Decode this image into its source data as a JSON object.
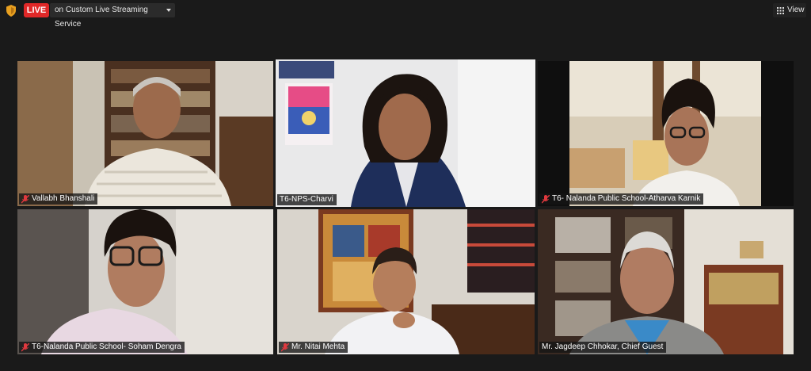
{
  "topbar": {
    "live_label": "LIVE",
    "stream_label": "on Custom Live Streaming Service",
    "view_label": "View"
  },
  "participants": [
    {
      "name": "Vallabh Bhanshali",
      "muted": true,
      "active": false
    },
    {
      "name": "T6-NPS-Charvi",
      "muted": false,
      "active": true
    },
    {
      "name": "T6- Nalanda Public School-Atharva Karnik",
      "muted": true,
      "active": false
    },
    {
      "name": "T6-Nalanda Public School- Soham Dengra",
      "muted": true,
      "active": false
    },
    {
      "name": "Mr. Nitai Mehta",
      "muted": true,
      "active": false
    },
    {
      "name": "Mr. Jagdeep Chhokar, Chief Guest",
      "muted": false,
      "active": false
    }
  ],
  "colors": {
    "live": "#e02828",
    "active_border": "#d4e35a",
    "muted_icon": "#e0393e"
  }
}
